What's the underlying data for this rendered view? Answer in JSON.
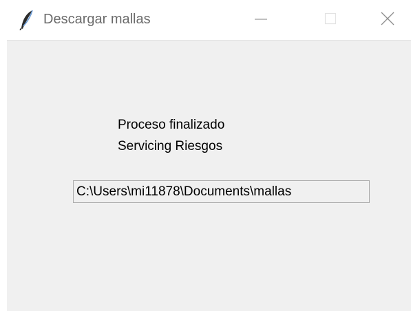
{
  "window": {
    "title": "Descargar mallas",
    "icon": "feather-icon",
    "controls": {
      "minimize": "minimize-icon",
      "maximize": "maximize-icon",
      "close": "close-icon"
    }
  },
  "content": {
    "status_line_1": "Proceso finalizado",
    "status_line_2": "Servicing Riesgos",
    "path_value": "C:\\Users\\mi11878\\Documents\\mallas"
  },
  "colors": {
    "client_bg": "#f0f0f0",
    "titlebar_bg": "#ffffff",
    "title_text": "#6b6b6b"
  }
}
